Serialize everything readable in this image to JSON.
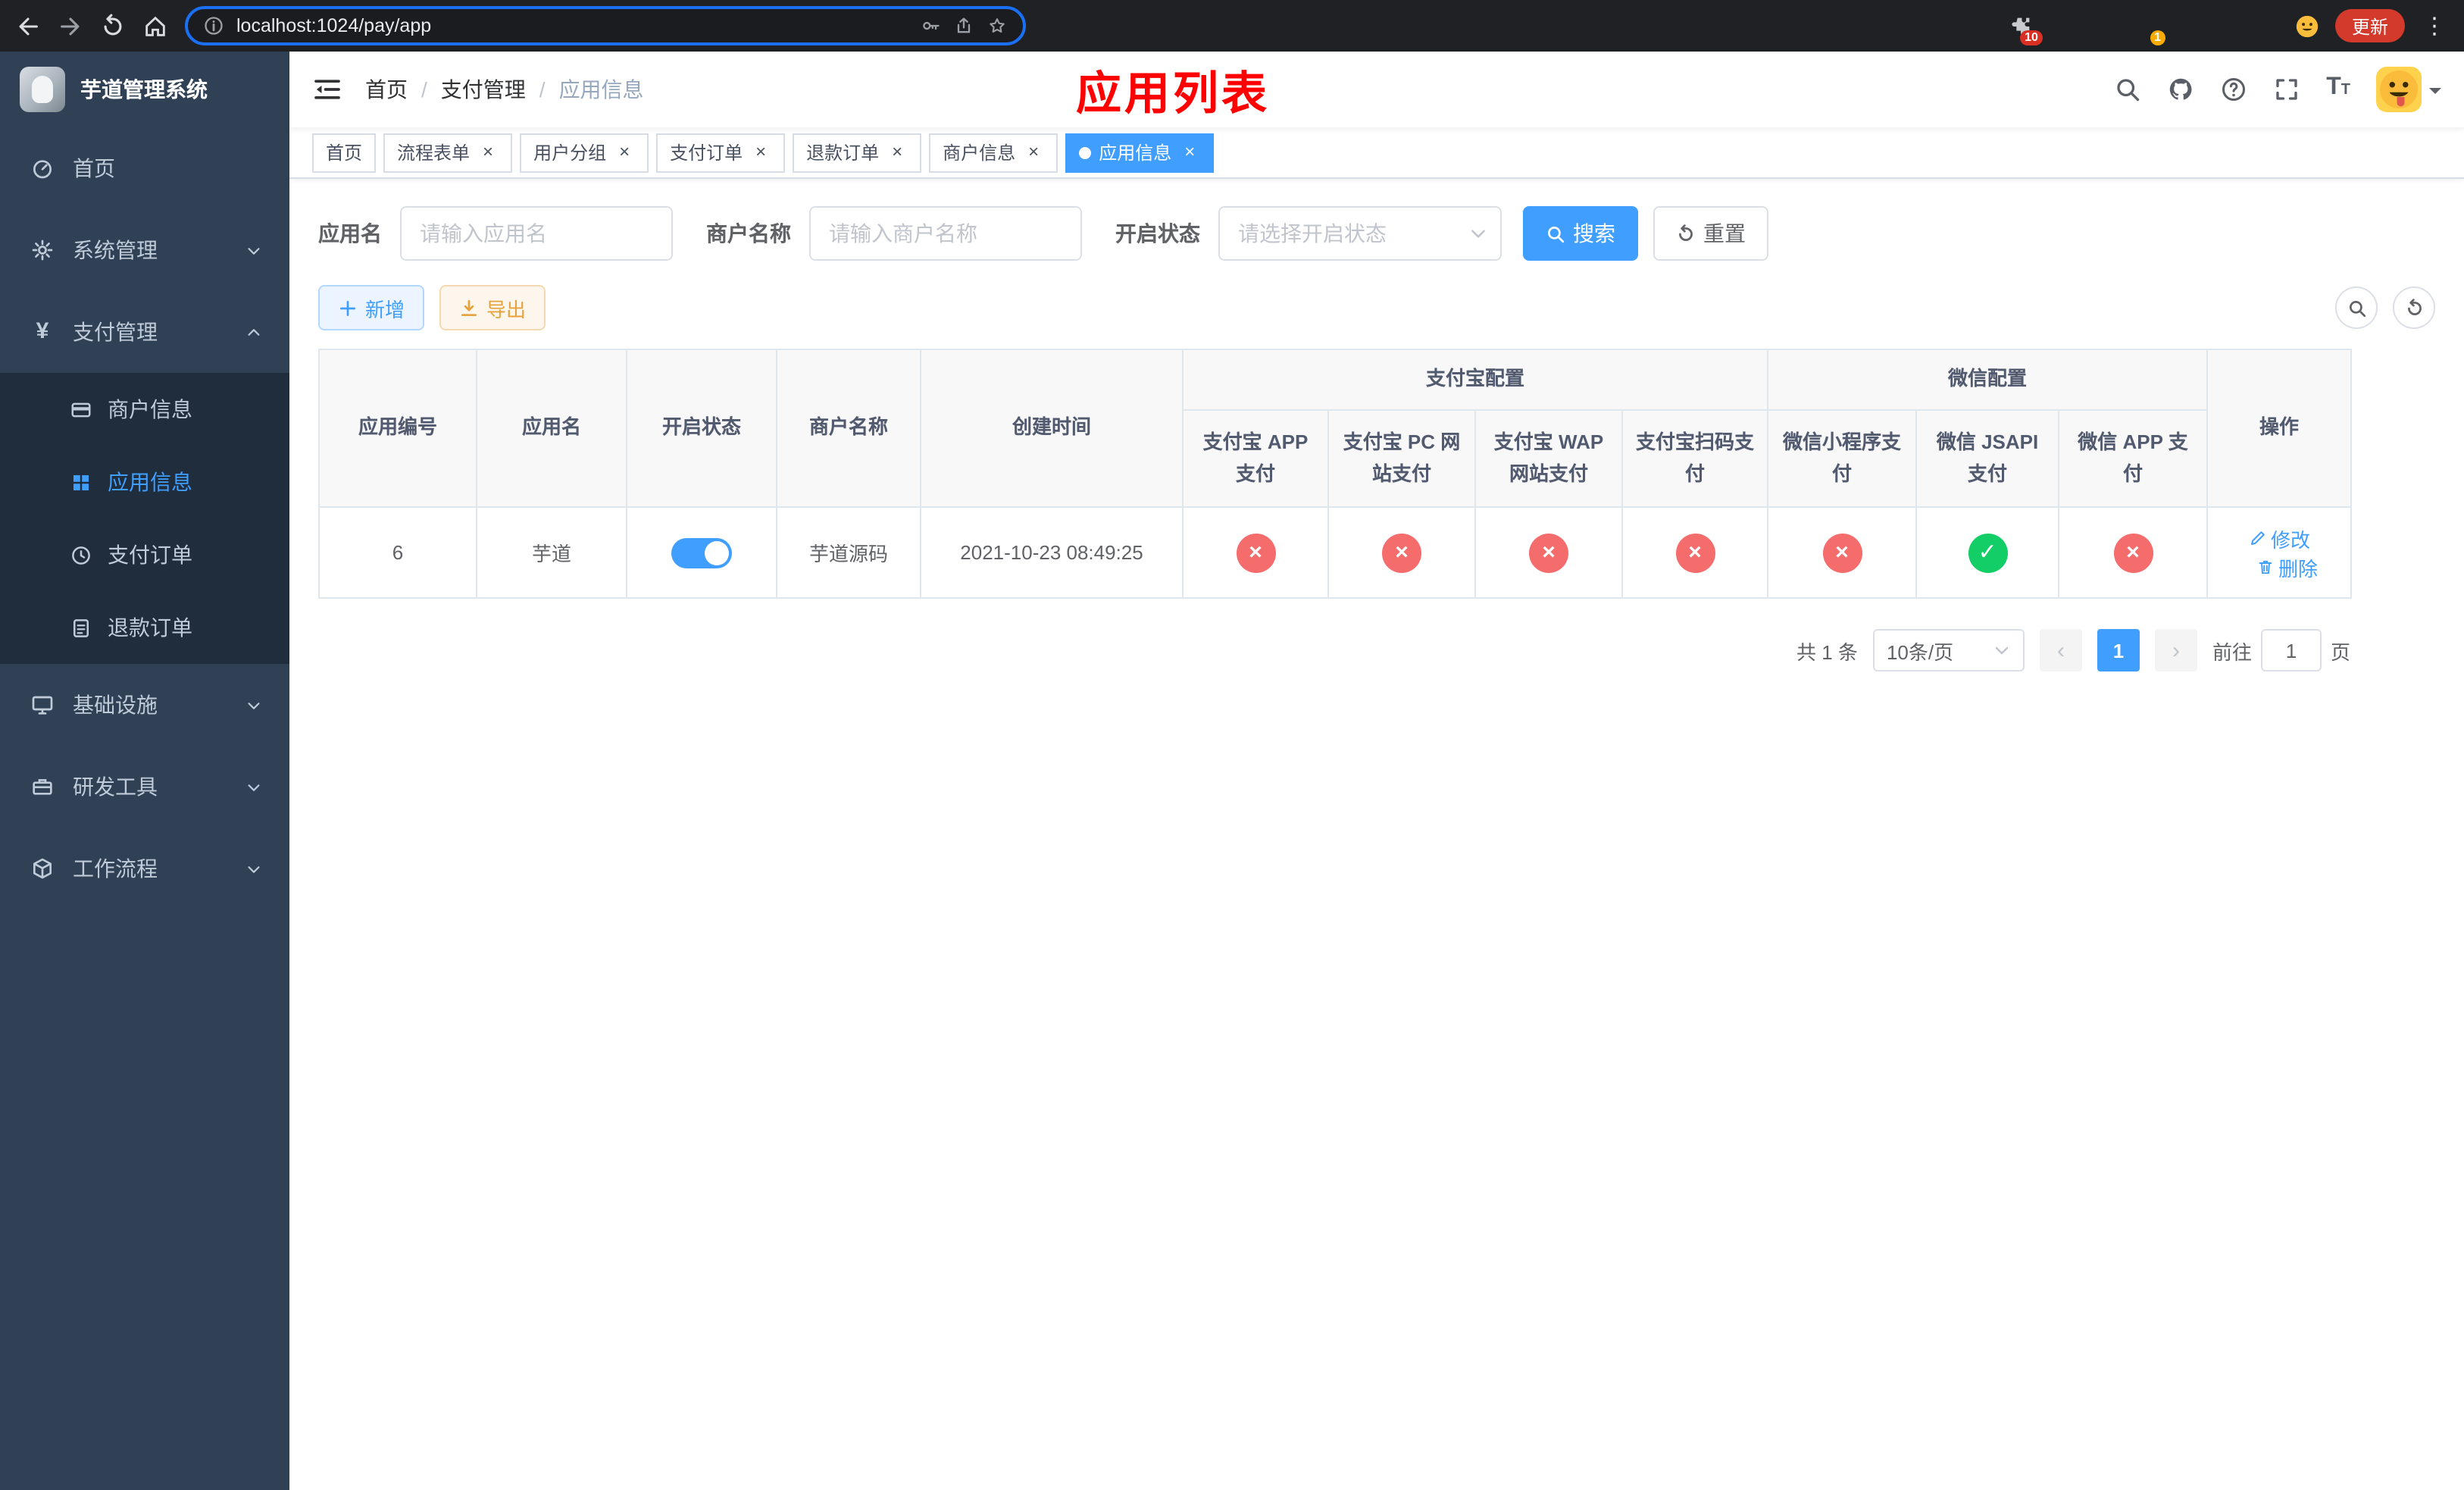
{
  "browser": {
    "url": "localhost:1024/pay/app",
    "update_button": "更新",
    "extensions_badge": "10",
    "extension_badge_green": "1"
  },
  "sidebar": {
    "logo_title": "芋道管理系统",
    "items": [
      {
        "label": "首页",
        "icon": "dashboard-icon"
      },
      {
        "label": "系统管理",
        "icon": "gear-icon",
        "expandable": true
      },
      {
        "label": "支付管理",
        "icon": "yen-icon",
        "expandable": true,
        "expanded": true,
        "children": [
          {
            "label": "商户信息",
            "icon": "credit-card-icon"
          },
          {
            "label": "应用信息",
            "icon": "grid-icon",
            "active": true
          },
          {
            "label": "支付订单",
            "icon": "clock-icon"
          },
          {
            "label": "退款订单",
            "icon": "document-icon"
          }
        ]
      },
      {
        "label": "基础设施",
        "icon": "monitor-icon",
        "expandable": true
      },
      {
        "label": "研发工具",
        "icon": "toolbox-icon",
        "expandable": true
      },
      {
        "label": "工作流程",
        "icon": "box-icon",
        "expandable": true
      }
    ]
  },
  "header": {
    "breadcrumb": [
      "首页",
      "支付管理",
      "应用信息"
    ],
    "page_annotation": "应用列表"
  },
  "tabs": [
    {
      "label": "首页",
      "closable": false,
      "active": false
    },
    {
      "label": "流程表单",
      "closable": true,
      "active": false
    },
    {
      "label": "用户分组",
      "closable": true,
      "active": false
    },
    {
      "label": "支付订单",
      "closable": true,
      "active": false
    },
    {
      "label": "退款订单",
      "closable": true,
      "active": false
    },
    {
      "label": "商户信息",
      "closable": true,
      "active": false
    },
    {
      "label": "应用信息",
      "closable": true,
      "active": true
    }
  ],
  "filters": {
    "app_name_label": "应用名",
    "app_name_placeholder": "请输入应用名",
    "merchant_name_label": "商户名称",
    "merchant_name_placeholder": "请输入商户名称",
    "status_label": "开启状态",
    "status_placeholder": "请选择开启状态",
    "search_button": "搜索",
    "reset_button": "重置"
  },
  "toolbar": {
    "add_button": "新增",
    "export_button": "导出"
  },
  "table": {
    "group_headers": {
      "alipay": "支付宝配置",
      "wechat": "微信配置"
    },
    "columns": [
      "应用编号",
      "应用名",
      "开启状态",
      "商户名称",
      "创建时间",
      "支付宝 APP 支付",
      "支付宝 PC 网站支付",
      "支付宝 WAP 网站支付",
      "支付宝扫码支付",
      "微信小程序支付",
      "微信 JSAPI 支付",
      "微信 APP 支付",
      "操作"
    ],
    "rows": [
      {
        "id": "6",
        "app_name": "芋道",
        "status_on": true,
        "merchant_name": "芋道源码",
        "create_time": "2021-10-23 08:49:25",
        "configs": [
          "no",
          "no",
          "no",
          "no",
          "no",
          "yes",
          "no"
        ],
        "edit_label": "修改",
        "delete_label": "删除"
      }
    ]
  },
  "pagination": {
    "total_text": "共 1 条",
    "page_size": "10条/页",
    "current_page": "1",
    "goto_prefix": "前往",
    "goto_value": "1",
    "goto_suffix": "页"
  },
  "colors": {
    "accent": "#409eff",
    "sidebar_bg": "#304156",
    "submenu_bg": "#1f2d3d",
    "error": "#f56c6c",
    "success": "#13ce66",
    "warning": "#e6a23c",
    "annotation_red": "#ff0000",
    "active_tab": "#409eff"
  },
  "icons": [
    "back-icon",
    "forward-icon",
    "reload-icon",
    "home-icon",
    "info-icon",
    "key-icon",
    "share-icon",
    "star-icon",
    "puzzle-icon",
    "menu-dots-icon",
    "hamburger-icon",
    "search-icon",
    "github-icon",
    "help-icon",
    "fullscreen-icon",
    "font-size-icon",
    "chevron-down-icon",
    "plus-icon",
    "download-icon",
    "magnifier-circle-icon",
    "refresh-circle-icon",
    "edit-icon",
    "delete-icon",
    "close-icon",
    "check-icon",
    "x-icon"
  ]
}
